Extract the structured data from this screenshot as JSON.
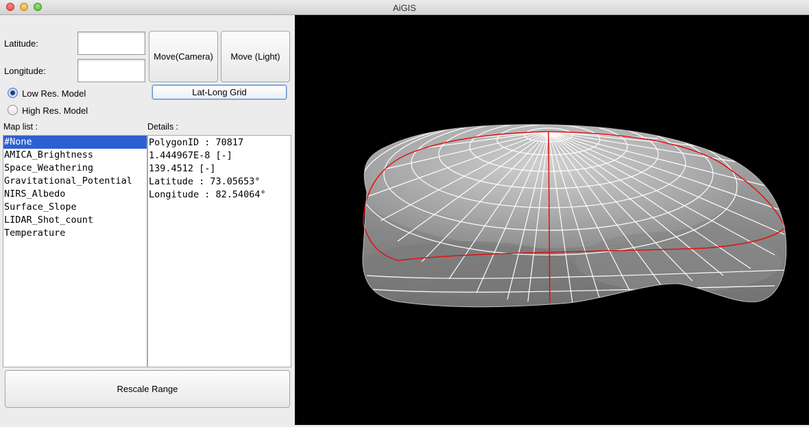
{
  "window": {
    "title": "AiGIS"
  },
  "inputs": {
    "latitude_label": "Latitude:",
    "latitude_value": "",
    "longitude_label": "Longitude:",
    "longitude_value": ""
  },
  "buttons": {
    "move_camera": "Move(Camera)",
    "move_light": "Move (Light)",
    "lat_long_grid": "Lat-Long Grid",
    "rescale_range": "Rescale Range"
  },
  "model_options": [
    {
      "label": "Low Res. Model",
      "selected": true
    },
    {
      "label": "High Res. Model",
      "selected": false
    }
  ],
  "map_list": {
    "label": "Map list :",
    "items": [
      "#None",
      "AMICA_Brightness",
      "Space_Weathering",
      "Gravitational_Potential",
      "NIRS_Albedo",
      "Surface_Slope",
      "LIDAR_Shot_count",
      "Temperature"
    ],
    "selected_index": 0
  },
  "details": {
    "label": "Details :",
    "lines": [
      "PolygonID : 70817",
      "1.444967E-8 [-]",
      "139.4512 [-]",
      "Latitude : 73.05653°",
      "Longitude : 82.54064°"
    ]
  },
  "viewport": {
    "background": "#000000",
    "body_color": "#9a9a9a",
    "grid_color": "#ffffff",
    "meridian_color": "#e01010"
  }
}
